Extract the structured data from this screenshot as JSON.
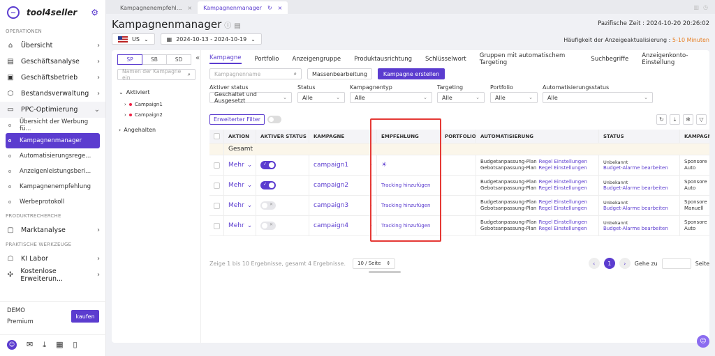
{
  "brand": {
    "name": "tool4seller"
  },
  "sidebar": {
    "sections": [
      "OPERATIONEN",
      "PRODUKTRECHERCHE",
      "PRAKTISCHE WERKZEUGE"
    ],
    "items": [
      {
        "label": "Übersicht"
      },
      {
        "label": "Geschäftsanalyse"
      },
      {
        "label": "Geschäftsbetrieb"
      },
      {
        "label": "Bestandsverwaltung"
      },
      {
        "label": "PPC-Optimierung"
      }
    ],
    "ppc_sub": [
      {
        "label": "Übersicht der Werbung fü..."
      },
      {
        "label": "Kampagnenmanager"
      },
      {
        "label": "Automatisierungsrege..."
      },
      {
        "label": "Anzeigenleistungsberi..."
      },
      {
        "label": "Kampagnenempfehlung"
      },
      {
        "label": "Werbeprotokoll"
      }
    ],
    "research": [
      {
        "label": "Marktanalyse"
      }
    ],
    "tools": [
      {
        "label": "KI Labor"
      },
      {
        "label": "Kostenlose Erweiterun..."
      }
    ],
    "plan": {
      "demo": "DEMO",
      "premium": "Premium",
      "buy": "kaufen"
    }
  },
  "browser_tabs": [
    {
      "label": "Kampagnenempfehl..."
    },
    {
      "label": "Kampagnenmanager"
    }
  ],
  "header": {
    "title": "Kampagnenmanager",
    "timezone": "Pazifische Zeit : 2024-10-20 20:26:02",
    "marketplace": "US",
    "date_range": "2024-10-13 - 2024-10-19",
    "frequency_label": "Häufigkeit der Anzeigeaktualisierung : ",
    "frequency_value": "5-10 Minuten"
  },
  "tree": {
    "segments": [
      "SP",
      "SB",
      "SD"
    ],
    "search_placeholder": "Namen der Kampagne ein",
    "active_label": "Aktiviert",
    "paused_label": "Angehalten",
    "campaigns": [
      "Campaign1",
      "Campaign2"
    ]
  },
  "tabs": [
    "Kampagne",
    "Portfolio",
    "Anzeigengruppe",
    "Produktausrichtung",
    "Schlüsselwort",
    "Gruppen mit automatischem Targeting",
    "Suchbegriffe",
    "Anzeigenkonto-Einstellung"
  ],
  "toolbar": {
    "search_placeholder": "Kampagnenname",
    "bulk_edit": "Massenbearbeitung",
    "create": "Kampagne erstellen"
  },
  "filters": {
    "labels": [
      "Aktiver status",
      "Status",
      "Kampagnentyp",
      "Targeting",
      "Portfolio",
      "Automatisierungsstatus"
    ],
    "values": [
      "Geschaltet und Ausgesetzt",
      "Alle",
      "Alle",
      "Alle",
      "Alle",
      "Alle"
    ]
  },
  "advanced_filter": "Erweiterter Filter",
  "table": {
    "headers": [
      "AKTION",
      "AKTIVER STATUS",
      "KAMPAGNE",
      "EMPFEHLUNG",
      "PORTFOLIO",
      "AUTOMATISIERUNG",
      "STATUS",
      "KAMPAGN"
    ],
    "total_label": "Gesamt",
    "action_label": "Mehr",
    "rows": [
      {
        "active": true,
        "campaign": "campaign1",
        "recommendation": "",
        "status": "Unbekannt",
        "type1": "Sponsore",
        "type2": "Auto"
      },
      {
        "active": true,
        "campaign": "campaign2",
        "recommendation": "Tracking hinzufügen",
        "status": "Unbekannt",
        "type1": "Sponsore",
        "type2": "Auto"
      },
      {
        "active": false,
        "campaign": "campaign3",
        "recommendation": "Tracking hinzufügen",
        "status": "Unbekannt",
        "type1": "Sponsore",
        "type2": "Manuell"
      },
      {
        "active": false,
        "campaign": "campaign4",
        "recommendation": "Tracking hinzufügen",
        "status": "Unbekannt",
        "type1": "Sponsore",
        "type2": "Auto"
      }
    ],
    "automation": {
      "budget_plan": "Budgetanpassung-Plan",
      "bid_plan": "Gebotsanpassung-Plan",
      "rule_settings": "Regel Einstellungen",
      "budget_alarm": "Budget-Alarme bearbeiten"
    }
  },
  "pager": {
    "summary": "Zeige 1 bis 10 Ergebnisse, gesamt 4 Ergebnisse.",
    "page_size": "10 / Seite",
    "current_page": "1",
    "goto": "Gehe zu",
    "page_word": "Seite"
  },
  "colors": {
    "accent": "#5b3ccf",
    "highlight": "#e53935",
    "warning": "#e67e22"
  }
}
